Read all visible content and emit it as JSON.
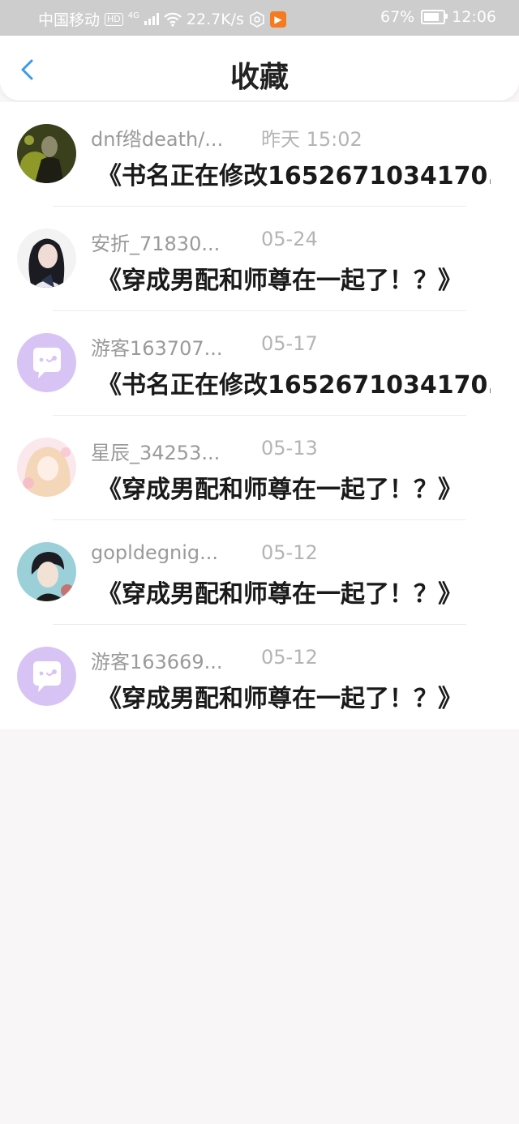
{
  "status_bar": {
    "carrier": "中国移动",
    "hd": "HD",
    "network": "4G",
    "speed": "22.7K/s",
    "battery": "67%",
    "time": "12:06"
  },
  "header": {
    "title": "收藏",
    "back_icon": "chevron-left-icon"
  },
  "items": [
    {
      "name": "dnf绺death/...",
      "time": "昨天 15:02",
      "book": "《书名正在修改1652671034170...",
      "avatar": "photo"
    },
    {
      "name": "安折_71830...",
      "time": "05-24",
      "book": "《穿成男配和师尊在一起了！？》",
      "avatar": "photo"
    },
    {
      "name": "游客163707...",
      "time": "05-17",
      "book": "《书名正在修改1652671034170...",
      "avatar": "chat-bubble-default"
    },
    {
      "name": "星辰_34253...",
      "time": "05-13",
      "book": "《穿成男配和师尊在一起了！？》",
      "avatar": "photo"
    },
    {
      "name": "gopldegnig...",
      "time": "05-12",
      "book": "《穿成男配和师尊在一起了！？》",
      "avatar": "photo"
    },
    {
      "name": "游客163669...",
      "time": "05-12",
      "book": "《穿成男配和师尊在一起了！？》",
      "avatar": "chat-bubble-default"
    }
  ],
  "colors": {
    "accent": "#3a9be6",
    "default_avatar": "#d7c4f5"
  }
}
